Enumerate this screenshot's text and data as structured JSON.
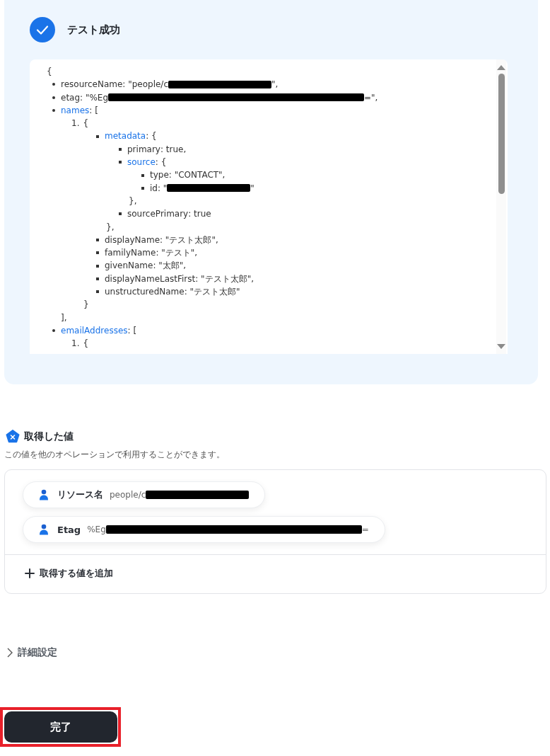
{
  "test_result": {
    "succeeded": true,
    "title": "テスト成功",
    "json_view": {
      "open": "{",
      "items": [
        {
          "kind": "disc",
          "key": "resourceName",
          "link": false,
          "parts": [
            {
              "kind": "text",
              "text": ": \"people/c"
            },
            {
              "kind": "redacted_medium"
            },
            {
              "kind": "text",
              "text": "\","
            }
          ]
        },
        {
          "kind": "disc",
          "key": "etag",
          "link": false,
          "parts": [
            {
              "kind": "text",
              "text": ": \"%Eg"
            },
            {
              "kind": "redacted_long"
            },
            {
              "kind": "text",
              "text": "=\","
            }
          ]
        },
        {
          "kind": "disc",
          "key": "names",
          "link": true,
          "parts": [
            {
              "kind": "text",
              "text": ": ["
            }
          ],
          "close": "],",
          "children": [
            {
              "kind": "number",
              "label": "1.",
              "parts": [
                {
                  "kind": "text",
                  "text": "{"
                }
              ],
              "close": "}",
              "children": [
                {
                  "kind": "square",
                  "key": "metadata",
                  "link": true,
                  "parts": [
                    {
                      "kind": "text",
                      "text": ": {"
                    }
                  ],
                  "close": "},",
                  "children": [
                    {
                      "kind": "square",
                      "key": "primary",
                      "link": false,
                      "parts": [
                        {
                          "kind": "text",
                          "text": ": true,"
                        }
                      ]
                    },
                    {
                      "kind": "square",
                      "key": "source",
                      "link": true,
                      "parts": [
                        {
                          "kind": "text",
                          "text": ": {"
                        }
                      ],
                      "close": "},",
                      "children": [
                        {
                          "kind": "square",
                          "key": "type",
                          "link": false,
                          "parts": [
                            {
                              "kind": "text",
                              "text": ": \"CONTACT\","
                            }
                          ]
                        },
                        {
                          "kind": "square",
                          "key": "id",
                          "link": false,
                          "parts": [
                            {
                              "kind": "text",
                              "text": ": \""
                            },
                            {
                              "kind": "redacted_short"
                            },
                            {
                              "kind": "text",
                              "text": "\""
                            }
                          ]
                        }
                      ]
                    },
                    {
                      "kind": "square",
                      "key": "sourcePrimary",
                      "link": false,
                      "parts": [
                        {
                          "kind": "text",
                          "text": ": true"
                        }
                      ]
                    }
                  ]
                },
                {
                  "kind": "square",
                  "key": "displayName",
                  "link": false,
                  "parts": [
                    {
                      "kind": "text",
                      "text": ": \"テスト太郎\","
                    }
                  ]
                },
                {
                  "kind": "square",
                  "key": "familyName",
                  "link": false,
                  "parts": [
                    {
                      "kind": "text",
                      "text": ": \"テスト\","
                    }
                  ]
                },
                {
                  "kind": "square",
                  "key": "givenName",
                  "link": false,
                  "parts": [
                    {
                      "kind": "text",
                      "text": ": \"太郎\","
                    }
                  ]
                },
                {
                  "kind": "square",
                  "key": "displayNameLastFirst",
                  "link": false,
                  "parts": [
                    {
                      "kind": "text",
                      "text": ": \"テスト太郎\","
                    }
                  ]
                },
                {
                  "kind": "square",
                  "key": "unstructuredName",
                  "link": false,
                  "parts": [
                    {
                      "kind": "text",
                      "text": ": \"テスト太郎\""
                    }
                  ]
                }
              ]
            }
          ]
        },
        {
          "kind": "disc",
          "key": "emailAddresses",
          "link": true,
          "parts": [
            {
              "kind": "text",
              "text": ": ["
            }
          ],
          "children": [
            {
              "kind": "number",
              "label": "1.",
              "parts": [
                {
                  "kind": "text",
                  "text": "{"
                }
              ]
            }
          ]
        }
      ]
    }
  },
  "values_section": {
    "title": "取得した値",
    "description": "この値を他のオペレーションで利用することができます。",
    "values": [
      {
        "label": "リソース名",
        "parts": [
          {
            "kind": "text",
            "text": "people/c"
          },
          {
            "kind": "redacted_medium"
          }
        ]
      },
      {
        "label": "Etag",
        "parts": [
          {
            "kind": "text",
            "text": "%Eg"
          },
          {
            "kind": "redacted_long"
          },
          {
            "kind": "text",
            "text": "="
          }
        ]
      }
    ],
    "add_button": "取得する値を追加"
  },
  "advanced_settings": {
    "label": "詳細設定",
    "expanded": false
  },
  "done_button": {
    "label": "完了",
    "highlighted": true
  }
}
